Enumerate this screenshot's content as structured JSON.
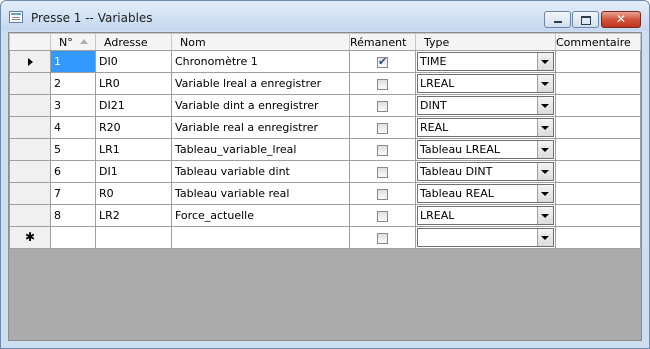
{
  "window": {
    "title": "Presse 1 -- Variables",
    "controls": {
      "minimize": "",
      "maximize": "",
      "close": "✕"
    }
  },
  "columns": {
    "num": "N°",
    "adresse": "Adresse",
    "nom": "Nom",
    "remanent": "Rémanent",
    "type": "Type",
    "commentaire": "Commentaire"
  },
  "rows": [
    {
      "num": "1",
      "adresse": "DI0",
      "nom": "Chronomètre 1",
      "remanent": true,
      "type": "TIME",
      "commentaire": ""
    },
    {
      "num": "2",
      "adresse": "LR0",
      "nom": "Variable lreal a enregistrer",
      "remanent": false,
      "type": "LREAL",
      "commentaire": ""
    },
    {
      "num": "3",
      "adresse": "DI21",
      "nom": "Variable dint a enregistrer",
      "remanent": false,
      "type": "DINT",
      "commentaire": ""
    },
    {
      "num": "4",
      "adresse": "R20",
      "nom": "Variable real a enregistrer",
      "remanent": false,
      "type": "REAL",
      "commentaire": ""
    },
    {
      "num": "5",
      "adresse": "LR1",
      "nom": "Tableau_variable_lreal",
      "remanent": false,
      "type": "Tableau LREAL",
      "commentaire": ""
    },
    {
      "num": "6",
      "adresse": "DI1",
      "nom": "Tableau variable dint",
      "remanent": false,
      "type": "Tableau DINT",
      "commentaire": ""
    },
    {
      "num": "7",
      "adresse": "R0",
      "nom": "Tableau variable real",
      "remanent": false,
      "type": "Tableau REAL",
      "commentaire": ""
    },
    {
      "num": "8",
      "adresse": "LR2",
      "nom": "Force_actuelle",
      "remanent": false,
      "type": "LREAL",
      "commentaire": ""
    }
  ],
  "new_row": {
    "marker": "✱",
    "type": ""
  },
  "selection_color": "#3399ff"
}
